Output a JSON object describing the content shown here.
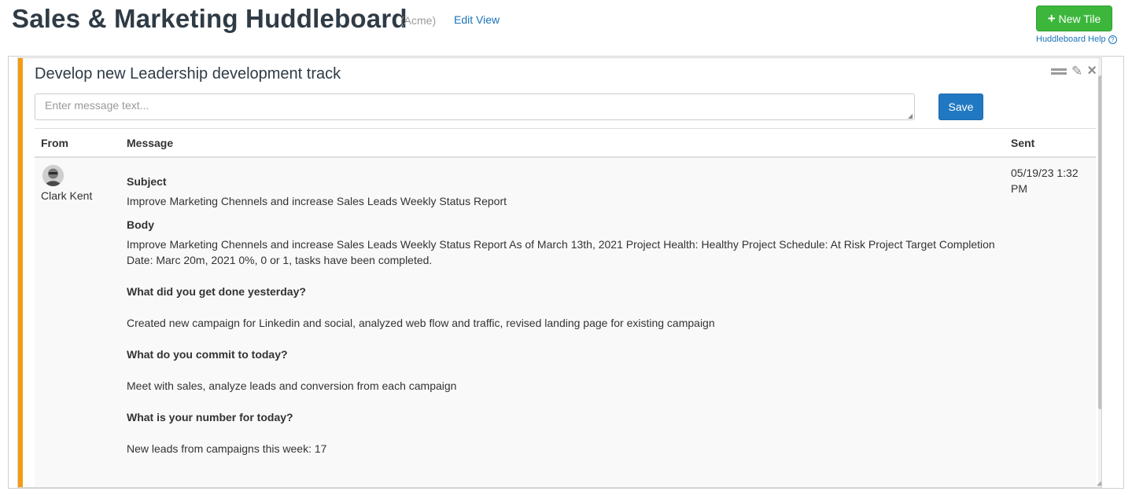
{
  "header": {
    "title": "Sales & Marketing Huddleboard",
    "org": "(Acme)",
    "edit_view": "Edit View",
    "new_tile": "New Tile",
    "help": "Huddleboard Help"
  },
  "tile": {
    "title": "Develop new Leadership development track",
    "input_placeholder": "Enter message text...",
    "save_label": "Save",
    "accent_color": "#f39c12",
    "columns": {
      "from": "From",
      "message": "Message",
      "sent": "Sent"
    },
    "messages": [
      {
        "from": "Clark Kent",
        "sent": "05/19/23 1:32 PM",
        "subject_label": "Subject",
        "subject": "Improve Marketing Chennels and increase Sales Leads Weekly Status Report",
        "body_label": "Body",
        "body": "Improve Marketing Chennels and increase Sales Leads Weekly Status Report As of March 13th, 2021 Project Health: Healthy Project Schedule: At Risk Project Target Completion Date: Marc 20m, 2021 0%, 0 or 1, tasks have been completed.",
        "q1": "What did you get done yesterday?",
        "a1": "Created new campaign for Linkedin and social, analyzed web flow and traffic, revised landing page for existing campaign",
        "q2": "What do you commit to today?",
        "a2": "Meet with sales, analyze leads and conversion from each campaign",
        "q3": "What is your number for today?",
        "a3": "New leads from campaigns this week: 17"
      }
    ]
  },
  "colors": {
    "primary_button": "#2178c2",
    "success_button": "#3cb73c",
    "link": "#1a73b8"
  },
  "icons": {
    "drag": "drag-handle-icon",
    "edit": "edit-icon",
    "close": "close-icon",
    "plus": "plus-icon",
    "help": "help-circle-icon"
  }
}
